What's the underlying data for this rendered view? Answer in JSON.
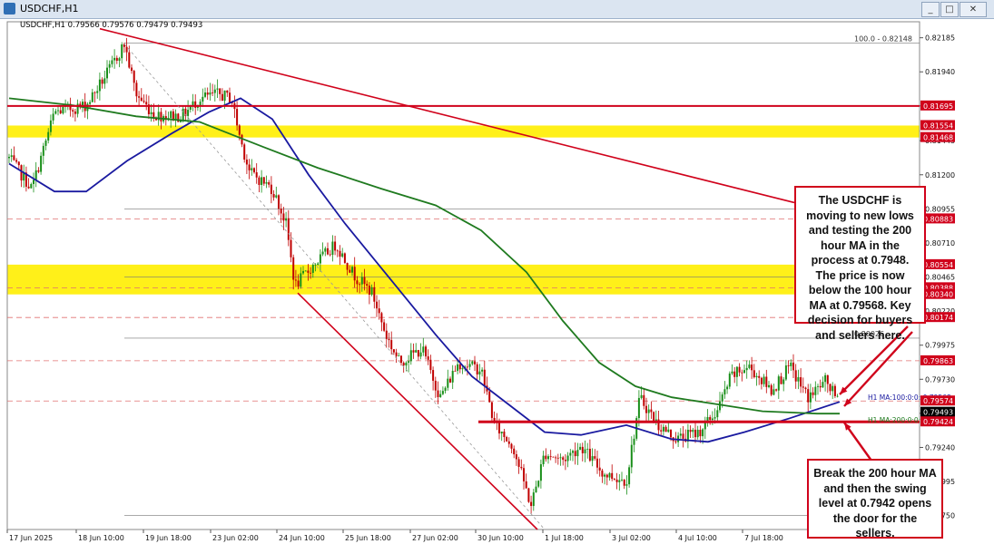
{
  "window": {
    "title": "USDCHF,H1",
    "buttons": [
      "_",
      "□",
      "✕"
    ]
  },
  "chart_data": {
    "type": "candlestick",
    "symbol_header": "USDCHF,H1  0.79566 0.79576 0.79479 0.79493",
    "ylim": [
      0.7865,
      0.823
    ],
    "price_ticks": [
      "0.82185",
      "0.81940",
      "0.81695",
      "0.81445",
      "0.81200",
      "0.80955",
      "0.80710",
      "0.80465",
      "0.80220",
      "0.79975",
      "0.79730",
      "0.79485",
      "0.79240",
      "0.78995",
      "0.78750"
    ],
    "x_ticks": [
      "17 Jun 2025",
      "18 Jun 10:00",
      "19 Jun 18:00",
      "23 Jun 02:00",
      "24 Jun 10:00",
      "25 Jun 18:00",
      "27 Jun 02:00",
      "30 Jun 10:00",
      "1 Jul 18:00",
      "3 Jul 02:00",
      "4 Jul 10:00",
      "7 Jul 18:00"
    ],
    "price_labels": [
      {
        "text": "0.81695",
        "value": 0.81695
      },
      {
        "text": "0.81554",
        "value": 0.81554
      },
      {
        "text": "0.81468",
        "value": 0.81468
      },
      {
        "text": "0.80883",
        "value": 0.80883
      },
      {
        "text": "0.80554",
        "value": 0.80554
      },
      {
        "text": "0.80388",
        "value": 0.80388
      },
      {
        "text": "0.80340",
        "value": 0.8034
      },
      {
        "text": "0.80174",
        "value": 0.80174
      },
      {
        "text": "0.79863",
        "value": 0.79863
      },
      {
        "text": "0.79574",
        "value": 0.79574
      },
      {
        "text": "0.79493",
        "value": 0.79493
      },
      {
        "text": "0.79424",
        "value": 0.79424
      }
    ],
    "fib_labels": [
      {
        "text": "100.0 - 0.82148",
        "value": 0.82148
      },
      {
        "text": "0.80026",
        "value": 0.80026
      }
    ],
    "ma_labels": [
      {
        "text": "H1 MA:100:0:0: 0.79568",
        "value": 0.79568,
        "color": "#1a1aa0"
      },
      {
        "text": "H1 MA:200:0:0: 0.79483",
        "value": 0.79483,
        "color": "#1f7a1f"
      }
    ],
    "horizontal_lines": [
      0.81695,
      0.79424
    ],
    "yellow_zones": [
      [
        0.81468,
        0.81554
      ],
      [
        0.8034,
        0.80554
      ]
    ],
    "dashed_levels": [
      0.80883,
      0.80388,
      0.80174,
      0.79863,
      0.79574
    ],
    "close_price": 0.79493,
    "colors": {
      "bull": "#1a8f1a",
      "bear": "#c00000",
      "ma100": "#1a1aa0",
      "ma200": "#1f7a1f",
      "trend": "#d0021b",
      "zone": "#ffee00",
      "price_label_bg": "#d0021b",
      "close_label_bg": "#000000"
    }
  },
  "annotations": {
    "ann1": "The USDCHF is moving to new lows and testing the 200 hour MA in the process at 0.7948. The price is now below the 100 hour MA at 0.79568.  Key decision for buyers and sellers here.",
    "ann2": "Break the 200 hour MA and then the swing level at 0.7942 opens the door for the sellers."
  }
}
